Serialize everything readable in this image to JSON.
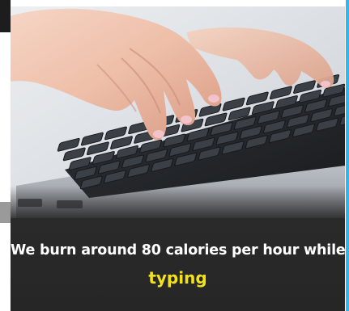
{
  "caption": {
    "line": "We burn around 80 calories per hour while",
    "highlight": "typing"
  },
  "colors": {
    "highlight": "#f2e21b",
    "caption_text": "#ffffff",
    "caption_bg": "#2a2a2a",
    "side_rule": "#35b6e6"
  }
}
